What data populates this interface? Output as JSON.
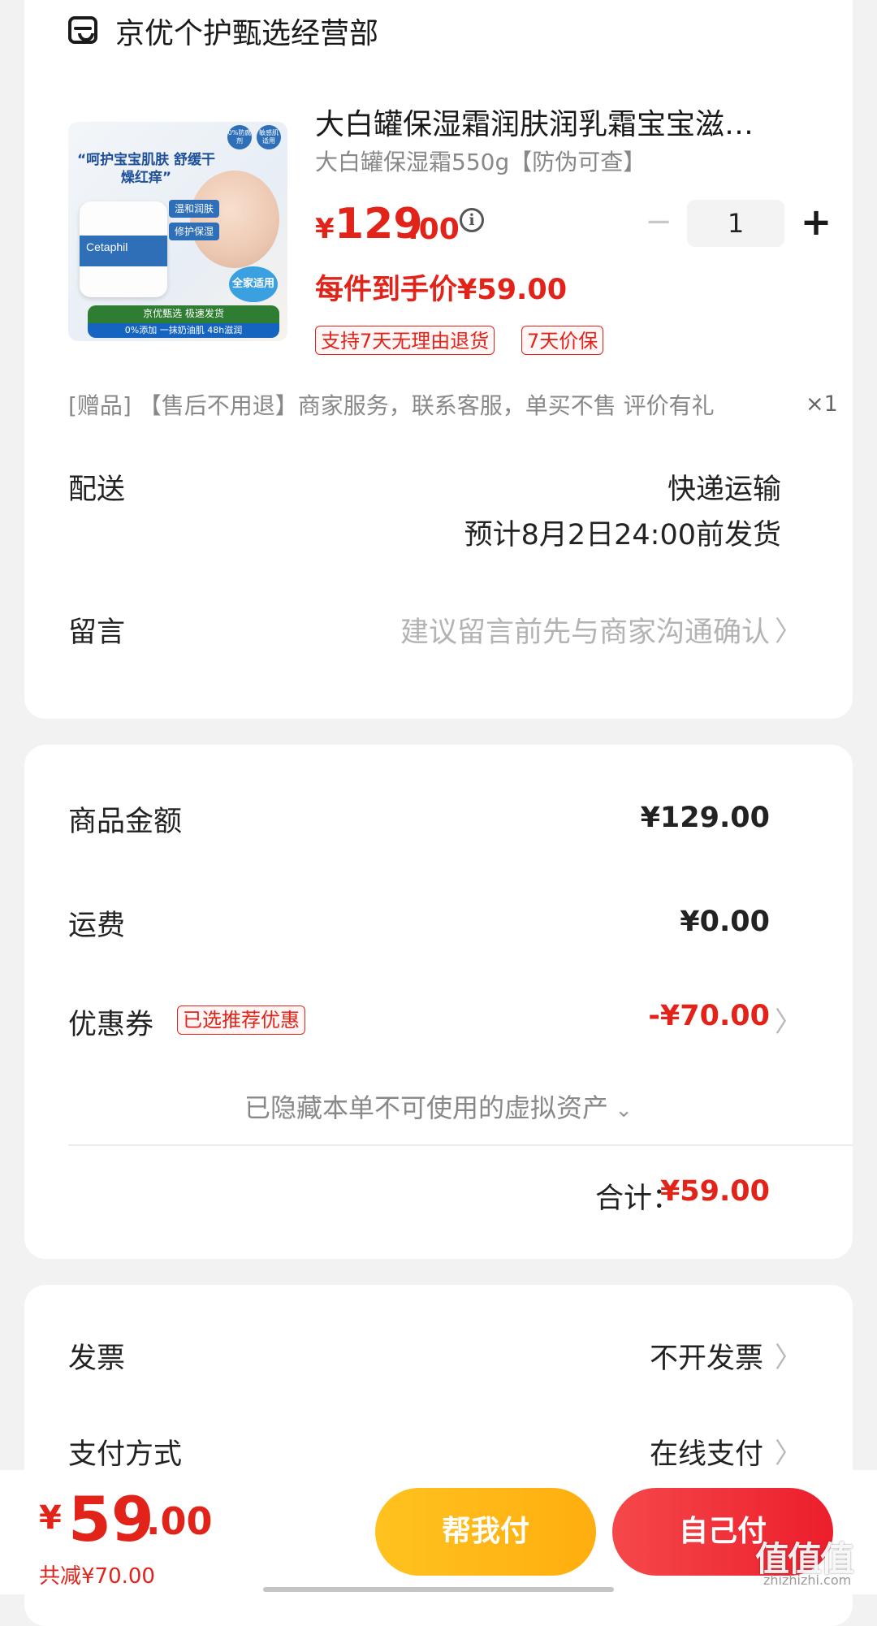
{
  "store": {
    "name": "京优个护甄选经营部"
  },
  "product": {
    "image_text": {
      "headline": "“呵护宝宝肌肤 舒缓干燥红痒”",
      "brand": "Cetaphil",
      "tag1": "温和润肤",
      "tag2": "修护保湿",
      "seal1": "0%防腐剂",
      "seal2": "敏感肌适用",
      "family": "全家适用",
      "banner": "京优甄选 极速发货",
      "banner2": "0%添加 一抹奶油肌 48h滋润"
    },
    "title": "大白罐保湿霜润肤润乳霜宝宝滋…",
    "spec": "大白罐保湿霜550g【防伪可查】",
    "price_symbol": "¥",
    "price_int": "129",
    "price_dec": ".00",
    "unit_price": "每件到手价¥59.00",
    "quantity": "1",
    "tags": [
      "支持7天无理由退货",
      "7天价保"
    ]
  },
  "gift": {
    "text": "[赠品] 【售后不用退】商家服务，联系客服，单买不售 评价有礼",
    "qty": "×1"
  },
  "delivery": {
    "label": "配送",
    "method": "快递运输",
    "eta": "预计8月2日24:00前发货"
  },
  "message": {
    "label": "留言",
    "placeholder": "建议留言前先与商家沟通确认"
  },
  "price_summary": {
    "goods_label": "商品金额",
    "goods_value": "¥129.00",
    "shipping_label": "运费",
    "shipping_value": "¥0.00",
    "coupon_label": "优惠券",
    "coupon_badge": "已选推荐优惠",
    "coupon_value": "-¥70.00",
    "hidden_assets": "已隐藏本单不可使用的虚拟资产",
    "total_label": "合计：",
    "total_value": "¥59.00"
  },
  "invoice": {
    "label": "发票",
    "value": "不开发票"
  },
  "payment": {
    "label": "支付方式",
    "value": "在线支付"
  },
  "checkout": {
    "symbol": "¥",
    "int": "59",
    "dec": ".00",
    "saved": "共减¥70.00",
    "pay_for_me": "帮我付",
    "pay_self": "自己付"
  },
  "watermark": {
    "text": "值值值",
    "sub": "zhizhizhi.com"
  },
  "colors": {
    "accent_red": "#e2231a",
    "yellow_button": "#ffb414",
    "red_button": "#ee2330"
  }
}
